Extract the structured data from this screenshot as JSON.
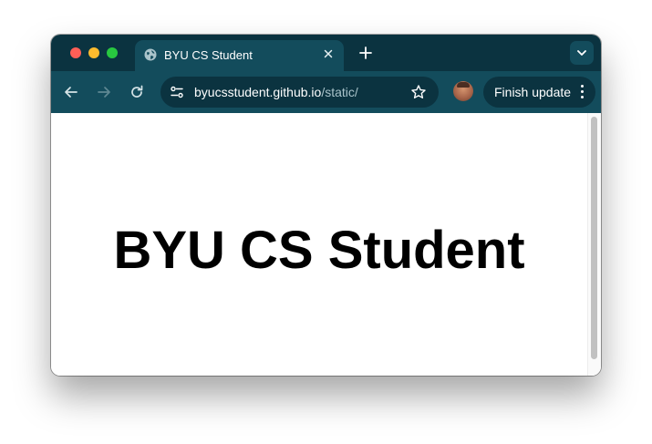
{
  "browser": {
    "tab": {
      "title": "BYU CS Student",
      "favicon": "globe-icon",
      "close_icon": "close-icon"
    },
    "new_tab_icon": "plus-icon",
    "tab_search_icon": "chevron-down-icon",
    "toolbar": {
      "back_icon": "arrow-left-icon",
      "forward_icon": "arrow-right-icon",
      "reload_icon": "reload-icon",
      "site_info_icon": "tune-icon",
      "url_host": "byucsstudent.github.io",
      "url_path": "/static/",
      "bookmark_icon": "star-icon",
      "profile_icon": "avatar",
      "finish_update_label": "Finish update",
      "menu_icon": "kebab-menu-icon"
    },
    "colors": {
      "tab_strip": "#0b3340",
      "toolbar": "#134c5c",
      "omnibox": "#0b3340"
    }
  },
  "page": {
    "heading": "BYU CS Student"
  }
}
